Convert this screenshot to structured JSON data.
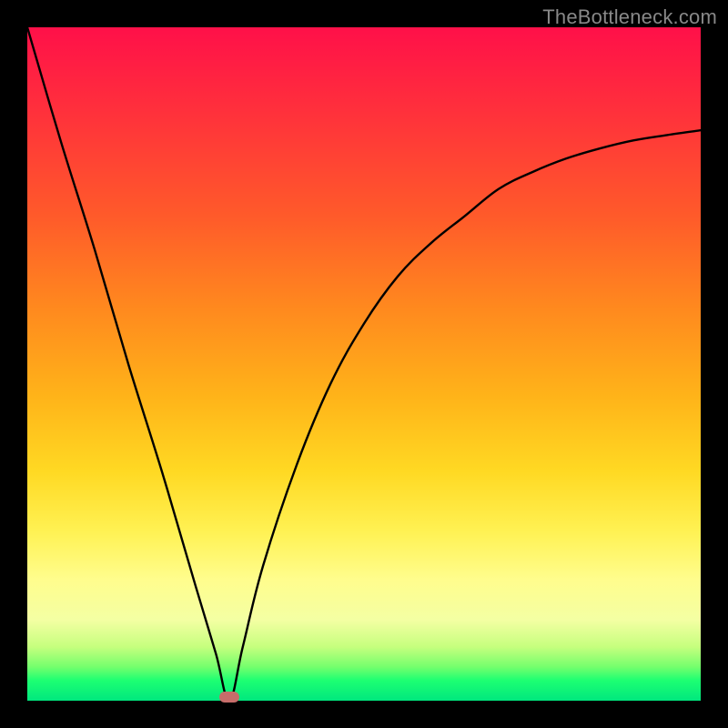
{
  "watermark": "TheBottleneck.com",
  "colors": {
    "black": "#000000",
    "curve": "#000000",
    "marker": "#c76d6a",
    "watermark_text": "#888888",
    "gradient_stops": [
      "#ff1049",
      "#ff2f3c",
      "#ff5a2a",
      "#ff8a1e",
      "#ffb419",
      "#ffd923",
      "#fff254",
      "#fffd8d",
      "#f4ffa3",
      "#c6ff7e",
      "#74ff6d",
      "#1dff72",
      "#00e77e"
    ]
  },
  "chart_data": {
    "type": "line",
    "title": "",
    "xlabel": "",
    "ylabel": "",
    "xlim": [
      0,
      100
    ],
    "ylim": [
      0,
      100
    ],
    "grid": false,
    "legend": false,
    "notes": "V-shaped curve; green band at bottom indicates optimal / low bottleneck, red at top indicates high bottleneck. Minimum at x≈30.",
    "series": [
      {
        "name": "bottleneck-curve",
        "x": [
          0,
          5,
          10,
          15,
          20,
          25,
          28,
          30,
          32,
          35,
          40,
          45,
          50,
          55,
          60,
          65,
          70,
          75,
          80,
          85,
          90,
          95,
          100
        ],
        "values": [
          100,
          83,
          67,
          50,
          34,
          17,
          7,
          0,
          8,
          20,
          35,
          47,
          56,
          63,
          68,
          72,
          76,
          78.5,
          80.5,
          82,
          83.2,
          84,
          84.7
        ]
      }
    ],
    "marker": {
      "x": 30,
      "y": 0,
      "shape": "rounded-rect",
      "color": "#c76d6a"
    }
  }
}
